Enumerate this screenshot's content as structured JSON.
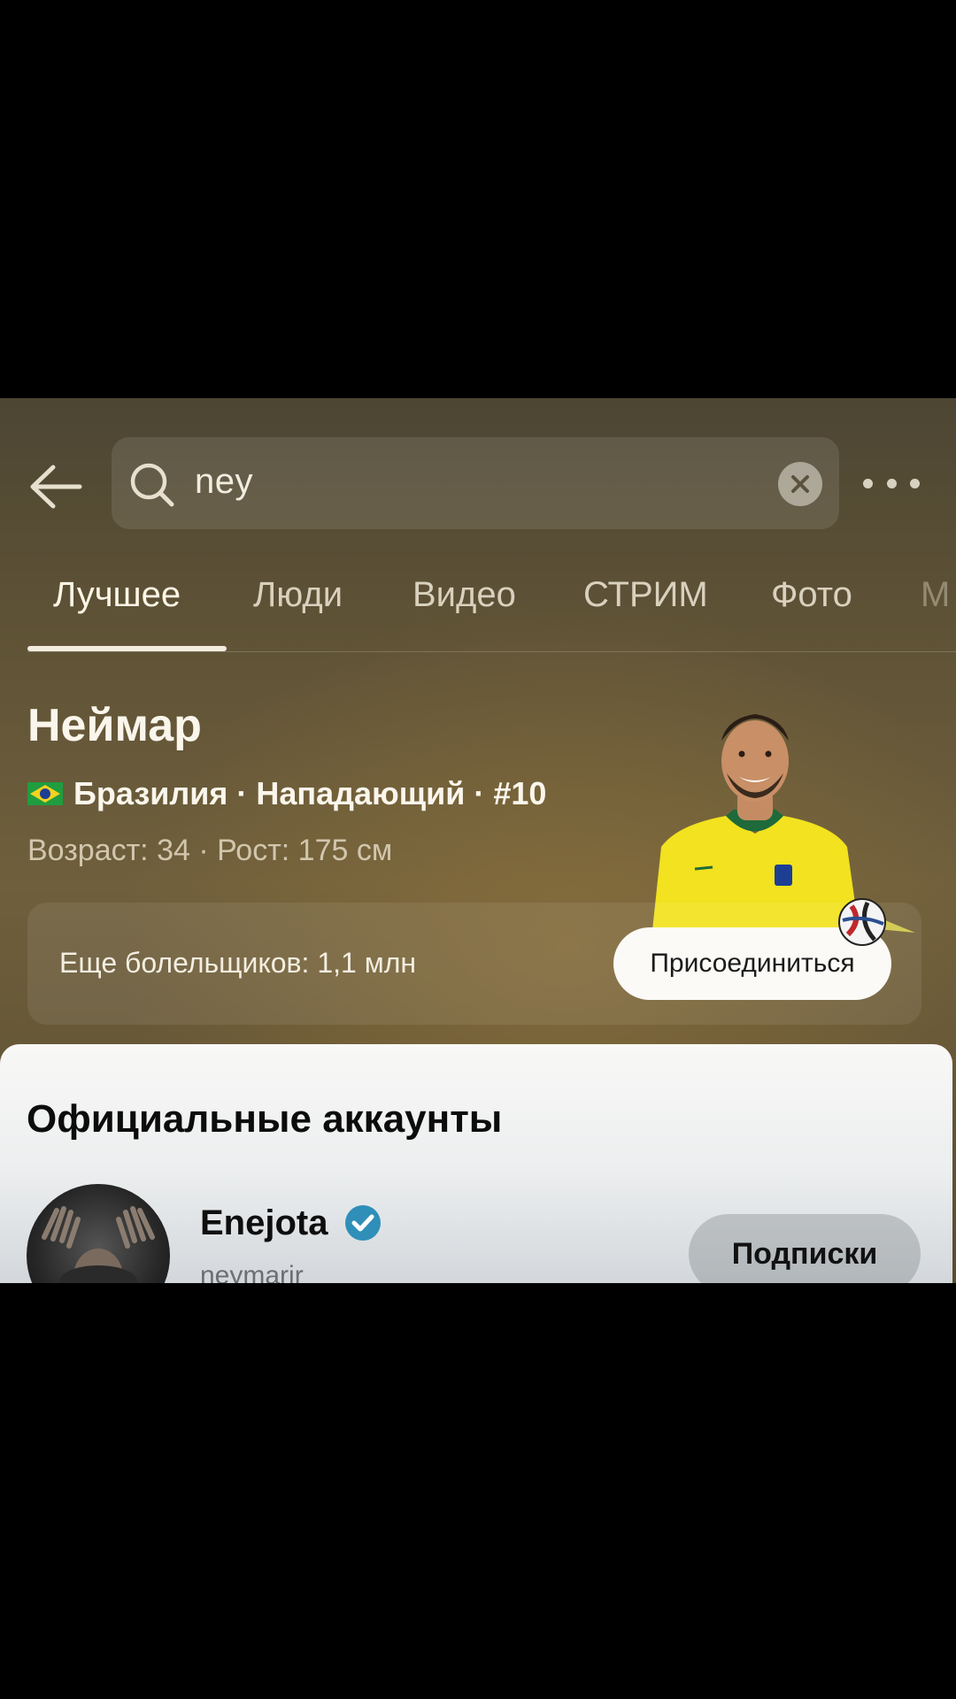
{
  "search": {
    "query": "ney"
  },
  "tabs": [
    {
      "label": "Лучшее"
    },
    {
      "label": "Люди"
    },
    {
      "label": "Видео"
    },
    {
      "label": "СТРИМ"
    },
    {
      "label": "Фото"
    },
    {
      "label": "М"
    }
  ],
  "player": {
    "name": "Неймар",
    "meta": "Бразилия · Нападающий · #10",
    "stats": "Возраст: 34 · Рост: 175 см"
  },
  "fans": {
    "text": "Еще болельщиков: 1,1 млн",
    "join_label": "Присоединиться"
  },
  "official": {
    "title": "Официальные аккаунты",
    "account": {
      "name": "Enejota",
      "handle": "neymarjr",
      "follow_label": "Подписки"
    }
  },
  "icons": {
    "back": "arrow-left-icon",
    "search": "search-icon",
    "clear": "clear-icon",
    "more": "more-dots-icon",
    "flag": "brazil-flag-icon",
    "verified": "verified-badge-icon",
    "ball": "football-icon"
  },
  "colors": {
    "background_top": "#4d4633",
    "background_mid": "#6f5f3c",
    "join_button": "#fbfaf7",
    "verified": "#2f8fb8",
    "jersey": "#f2e21f"
  }
}
